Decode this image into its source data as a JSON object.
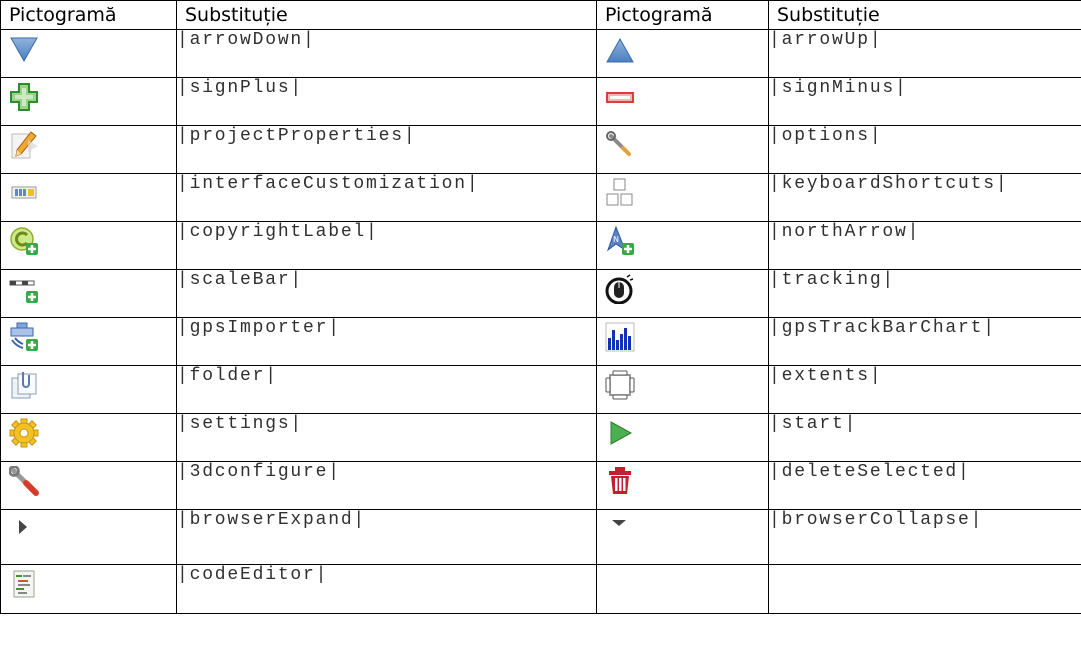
{
  "headers": [
    "Pictogramă",
    "Substituție",
    "Pictogramă",
    "Substituție"
  ],
  "rows": [
    {
      "left": {
        "icon": "arrow-down-icon",
        "code": "|arrowDown|"
      },
      "right": {
        "icon": "arrow-up-icon",
        "code": "|arrowUp|"
      }
    },
    {
      "left": {
        "icon": "sign-plus-icon",
        "code": "|signPlus|"
      },
      "right": {
        "icon": "sign-minus-icon",
        "code": "|signMinus|"
      }
    },
    {
      "left": {
        "icon": "pencil-icon",
        "code": "|projectProperties|"
      },
      "right": {
        "icon": "wrench-small-icon",
        "code": "|options|"
      }
    },
    {
      "left": {
        "icon": "toolbar-customize-icon",
        "code": "|interfaceCustomization|"
      },
      "right": {
        "icon": "keyboard-squares-icon",
        "code": "|keyboardShortcuts|"
      }
    },
    {
      "left": {
        "icon": "copyright-add-icon",
        "code": "|copyrightLabel|"
      },
      "right": {
        "icon": "north-arrow-add-icon",
        "code": "|northArrow|"
      }
    },
    {
      "left": {
        "icon": "scalebar-add-icon",
        "code": "|scaleBar|"
      },
      "right": {
        "icon": "tracking-mouse-icon",
        "code": "|tracking|"
      }
    },
    {
      "left": {
        "icon": "gps-import-add-icon",
        "code": "|gpsImporter|"
      },
      "right": {
        "icon": "bar-chart-icon",
        "code": "|gpsTrackBarChart|"
      }
    },
    {
      "left": {
        "icon": "folder-clip-icon",
        "code": "|folder|"
      },
      "right": {
        "icon": "extents-icon",
        "code": "|extents|"
      }
    },
    {
      "left": {
        "icon": "gear-icon",
        "code": "|settings|"
      },
      "right": {
        "icon": "play-icon",
        "code": "|start|"
      }
    },
    {
      "left": {
        "icon": "wrench-icon",
        "code": "|3dconfigure|"
      },
      "right": {
        "icon": "trash-icon",
        "code": "|deleteSelected|"
      }
    },
    {
      "left": {
        "icon": "triangle-right-icon",
        "code": "|browserExpand|"
      },
      "right": {
        "icon": "triangle-down-icon",
        "code": "|browserCollapse|"
      }
    },
    {
      "left": {
        "icon": "code-editor-icon",
        "code": "|codeEditor|"
      },
      "right": null
    }
  ]
}
